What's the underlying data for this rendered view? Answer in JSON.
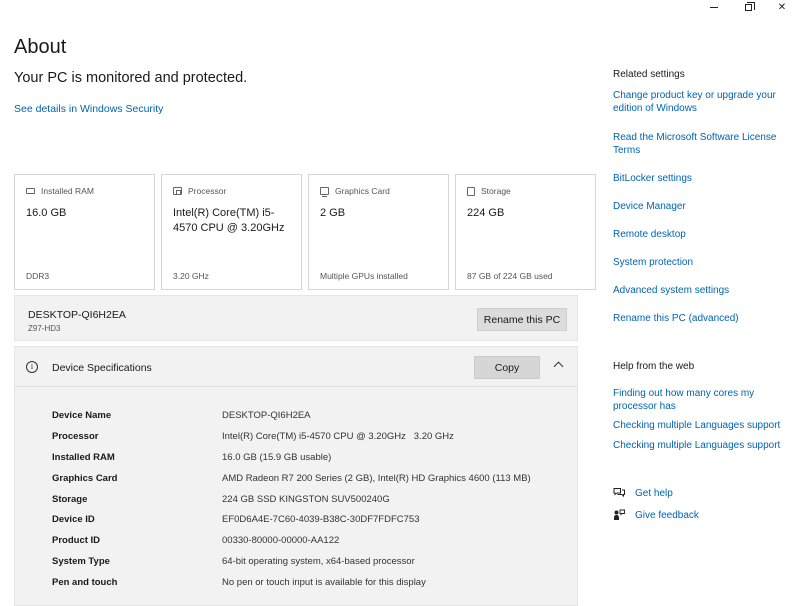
{
  "window": {
    "minimize_glyph": "",
    "restore_glyph": "",
    "close_glyph": "✕"
  },
  "header": {
    "title": "About",
    "protection_status": "Your PC is monitored and protected.",
    "security_link": "See details in Windows Security"
  },
  "cards": [
    {
      "icon": "ram-icon",
      "label": "Installed RAM",
      "value": "16.0 GB",
      "footer": "DDR3"
    },
    {
      "icon": "processor-icon",
      "label": "Processor",
      "value": "Intel(R) Core(TM) i5-4570 CPU @ 3.20GHz",
      "footer": "3.20 GHz"
    },
    {
      "icon": "graphics-card-icon",
      "label": "Graphics Card",
      "value": "2 GB",
      "footer": "Multiple GPUs installed"
    },
    {
      "icon": "storage-icon",
      "label": "Storage",
      "value": "224 GB",
      "footer": "87 GB of 224 GB used"
    }
  ],
  "pc": {
    "name": "DESKTOP-QI6H2EA",
    "model": "Z97-HD3",
    "rename_label": "Rename this PC"
  },
  "specs": {
    "title": "Device Specifications",
    "copy_label": "Copy",
    "info_glyph": "i",
    "rows": [
      {
        "label": "Device Name",
        "value": "DESKTOP-QI6H2EA"
      },
      {
        "label": "Processor",
        "value": "Intel(R) Core(TM) i5-4570 CPU @ 3.20GHz   3.20 GHz"
      },
      {
        "label": "Installed RAM",
        "value": "16.0 GB (15.9 GB usable)"
      },
      {
        "label": "Graphics Card",
        "value": "AMD Radeon R7 200 Series (2 GB), Intel(R) HD Graphics 4600 (113 MB)"
      },
      {
        "label": "Storage",
        "value": "224 GB SSD KINGSTON SUV500240G"
      },
      {
        "label": "Device ID",
        "value": "EF0D6A4E-7C60-4039-B38C-30DF7FDFC753"
      },
      {
        "label": "Product ID",
        "value": "00330-80000-00000-AA122"
      },
      {
        "label": "System Type",
        "value": "64-bit operating system, x64-based processor"
      },
      {
        "label": "Pen and touch",
        "value": "No pen or touch input is available for this display"
      }
    ]
  },
  "related": {
    "heading": "Related settings",
    "links": [
      "Change product key or upgrade your edition of Windows",
      "Read the Microsoft Software License Terms",
      "BitLocker settings",
      "Device Manager",
      "Remote desktop",
      "System protection",
      "Advanced system settings",
      "Rename this PC (advanced)"
    ]
  },
  "help": {
    "heading": "Help from the web",
    "links": [
      "Finding out how many cores my processor has",
      "Checking multiple Languages support",
      "Checking multiple Languages support"
    ],
    "get_help": "Get help",
    "give_feedback": "Give feedback"
  }
}
